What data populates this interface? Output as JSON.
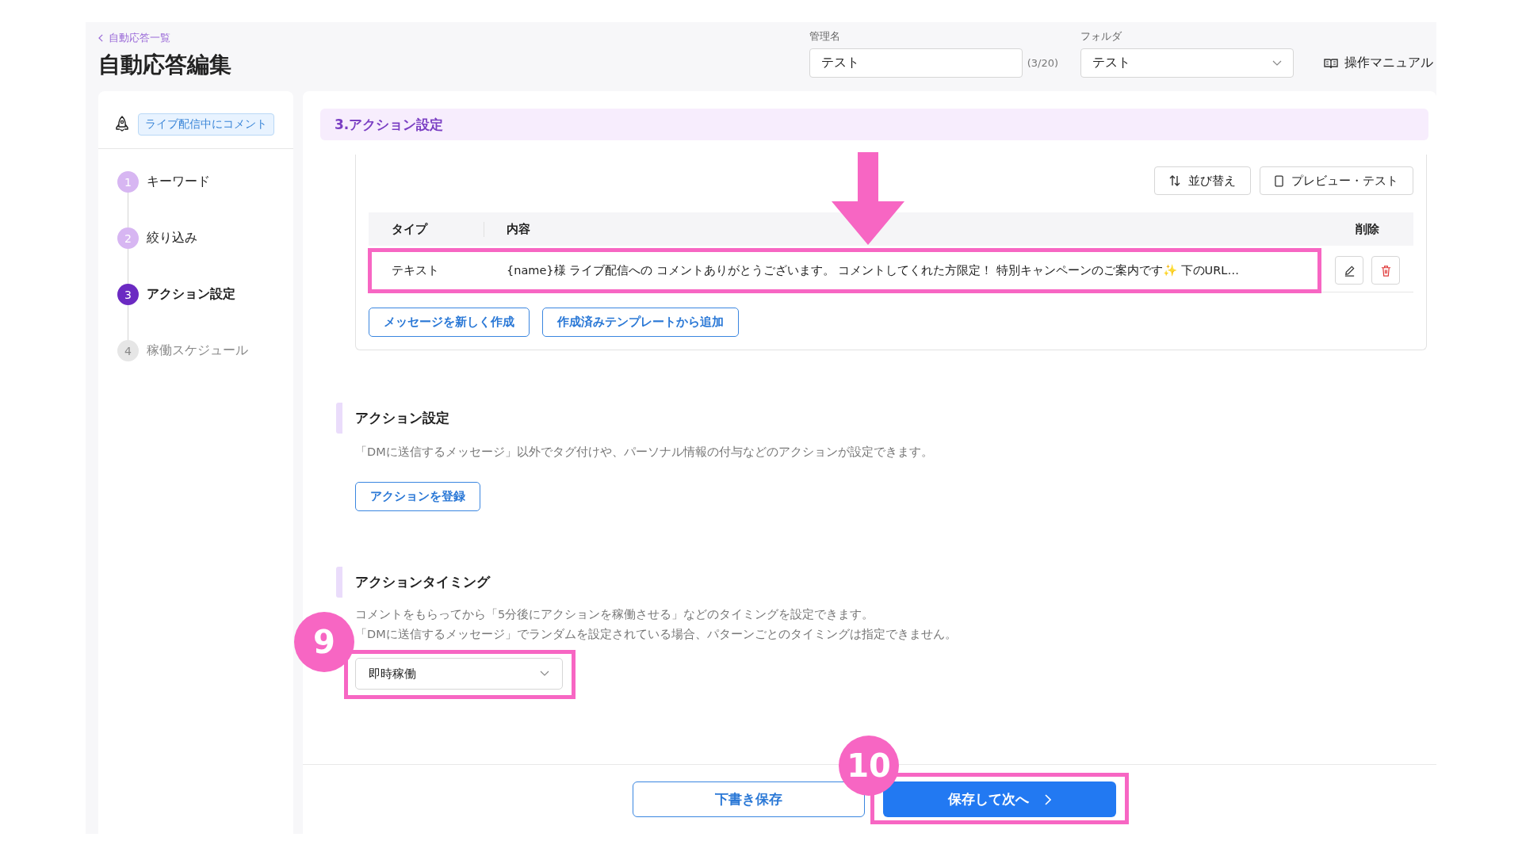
{
  "header": {
    "back_link": "自動応答一覧",
    "title": "自動応答編集"
  },
  "name_field": {
    "label": "管理名",
    "value": "テスト",
    "counter": "(3/20)"
  },
  "folder_field": {
    "label": "フォルダ",
    "value": "テスト"
  },
  "manual_link": "操作マニュアル",
  "sidebar": {
    "trigger_tag": "ライブ配信中にコメント",
    "steps": [
      {
        "number": "1",
        "label": "キーワード",
        "completed": true,
        "selected": false
      },
      {
        "number": "2",
        "label": "絞り込み",
        "completed": true,
        "selected": false
      },
      {
        "number": "3",
        "label": "アクション設定",
        "completed": false,
        "selected": true
      },
      {
        "number": "4",
        "label": "稼働スケジュール",
        "completed": false,
        "selected": false
      }
    ]
  },
  "section_title": "3.アクション設定",
  "messages": {
    "toolbar": [
      {
        "kind": "sort",
        "label": "並び替え"
      },
      {
        "kind": "preview",
        "label": "プレビュー・テスト"
      }
    ],
    "columns": [
      "タイプ",
      "内容",
      "削除"
    ],
    "rows": [
      {
        "type": "テキスト",
        "content": "{name}様 ライブ配信への コメントありがとうございます。 コメントしてくれた方限定！ 特別キャンペーンのご案内です✨ 下のURL…",
        "highlighted": true,
        "arrow": true
      }
    ],
    "buttons": [
      "メッセージを新しく作成",
      "作成済みテンプレートから追加"
    ]
  },
  "action_settings": {
    "heading": "アクション設定",
    "description": "「DMに送信するメッセージ」以外でタグ付けや、パーソナル情報の付与などのアクションが設定できます。",
    "button": "アクションを登録"
  },
  "action_timing": {
    "heading": "アクションタイミング",
    "description": [
      "コメントをもらってから「5分後にアクションを稼働させる」などのタイミングを設定できます。",
      "「DMに送信するメッセージ」でランダムを設定されている場合、パターンごとのタイミングは指定できません。"
    ],
    "select": {
      "value": "即時稼働",
      "highlighted": true,
      "callout": "9"
    }
  },
  "footer": {
    "draft_button": "下書き保存",
    "next_button": {
      "label": "保存して次へ",
      "highlighted": true,
      "callout": "10"
    }
  }
}
